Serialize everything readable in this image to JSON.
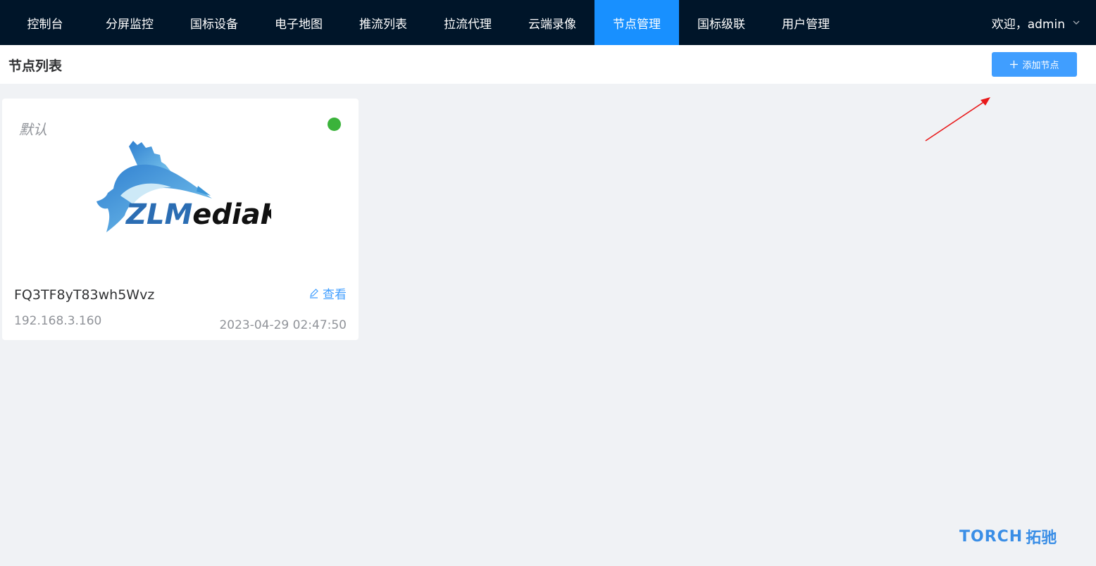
{
  "nav": {
    "items": [
      {
        "label": "控制台",
        "active": false
      },
      {
        "label": "分屏监控",
        "active": false
      },
      {
        "label": "国标设备",
        "active": false
      },
      {
        "label": "电子地图",
        "active": false
      },
      {
        "label": "推流列表",
        "active": false
      },
      {
        "label": "拉流代理",
        "active": false
      },
      {
        "label": "云端录像",
        "active": false
      },
      {
        "label": "节点管理",
        "active": true
      },
      {
        "label": "国标级联",
        "active": false
      },
      {
        "label": "用户管理",
        "active": false
      }
    ],
    "user_greeting": "欢迎，admin",
    "user_icon": "chevron-down-icon"
  },
  "header": {
    "title": "节点列表",
    "add_button_label": "添加节点",
    "add_button_icon": "plus-icon"
  },
  "nodes": [
    {
      "tag": "默认",
      "status": "online",
      "status_color": "#3bb33b",
      "logo_text": "ZLMediaKit",
      "id": "FQ3TF8yT83wh5Wvz",
      "view_label": "查看",
      "ip": "192.168.3.160",
      "time": "2023-04-29 02:47:50"
    }
  ],
  "watermark": {
    "en": "TORCH",
    "cn": "拓驰"
  },
  "colors": {
    "nav_bg": "#001529",
    "nav_active": "#1890ff",
    "primary": "#409eff",
    "page_bg": "#f0f2f5"
  }
}
